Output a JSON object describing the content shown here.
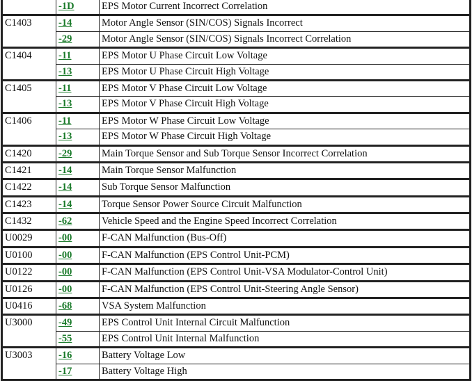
{
  "groups": [
    {
      "code": "",
      "items": [
        {
          "sub": "-1D",
          "desc": "EPS Motor Current Incorrect Correlation"
        }
      ]
    },
    {
      "code": "C1403",
      "items": [
        {
          "sub": "-14",
          "desc": "Motor Angle Sensor (SIN/COS) Signals Incorrect"
        },
        {
          "sub": "-29",
          "desc": "Motor Angle Sensor (SIN/COS) Signals Incorrect Correlation"
        }
      ]
    },
    {
      "code": "C1404",
      "items": [
        {
          "sub": "-11",
          "desc": "EPS Motor U Phase Circuit Low Voltage"
        },
        {
          "sub": "-13",
          "desc": "EPS Motor U Phase Circuit High Voltage"
        }
      ]
    },
    {
      "code": "C1405",
      "items": [
        {
          "sub": "-11",
          "desc": "EPS Motor V Phase Circuit Low Voltage"
        },
        {
          "sub": "-13",
          "desc": "EPS Motor V Phase Circuit High Voltage"
        }
      ]
    },
    {
      "code": "C1406",
      "items": [
        {
          "sub": "-11",
          "desc": "EPS Motor W Phase Circuit Low Voltage"
        },
        {
          "sub": "-13",
          "desc": "EPS Motor W Phase Circuit High Voltage"
        }
      ]
    },
    {
      "code": "C1420",
      "items": [
        {
          "sub": "-29",
          "desc": "Main Torque Sensor and Sub Torque Sensor Incorrect Correlation"
        }
      ]
    },
    {
      "code": "C1421",
      "items": [
        {
          "sub": "-14",
          "desc": "Main Torque Sensor Malfunction"
        }
      ]
    },
    {
      "code": "C1422",
      "items": [
        {
          "sub": "-14",
          "desc": "Sub Torque Sensor Malfunction"
        }
      ]
    },
    {
      "code": "C1423",
      "items": [
        {
          "sub": "-14",
          "desc": "Torque Sensor Power Source Circuit Malfunction"
        }
      ]
    },
    {
      "code": "C1432",
      "items": [
        {
          "sub": "-62",
          "desc": "Vehicle Speed and the Engine Speed Incorrect Correlation"
        }
      ]
    },
    {
      "code": "U0029",
      "items": [
        {
          "sub": "-00",
          "desc": "F-CAN Malfunction (Bus-Off)"
        }
      ]
    },
    {
      "code": "U0100",
      "items": [
        {
          "sub": "-00",
          "desc": "F-CAN Malfunction (EPS Control Unit-PCM)"
        }
      ]
    },
    {
      "code": "U0122",
      "items": [
        {
          "sub": "-00",
          "desc": "F-CAN Malfunction (EPS Control Unit-VSA Modulator-Control Unit)"
        }
      ]
    },
    {
      "code": "U0126",
      "items": [
        {
          "sub": "-00",
          "desc": "F-CAN Malfunction (EPS Control Unit-Steering Angle Sensor)"
        }
      ]
    },
    {
      "code": "U0416",
      "items": [
        {
          "sub": "-68",
          "desc": "VSA System Malfunction"
        }
      ]
    },
    {
      "code": "U3000",
      "items": [
        {
          "sub": "-49",
          "desc": "EPS Control Unit Internal Circuit Malfunction"
        },
        {
          "sub": "-55",
          "desc": "EPS Control Unit Internal Malfunction"
        }
      ]
    },
    {
      "code": "U3003",
      "items": [
        {
          "sub": "-16",
          "desc": "Battery Voltage Low"
        },
        {
          "sub": "-17",
          "desc": "Battery Voltage High"
        }
      ]
    }
  ]
}
